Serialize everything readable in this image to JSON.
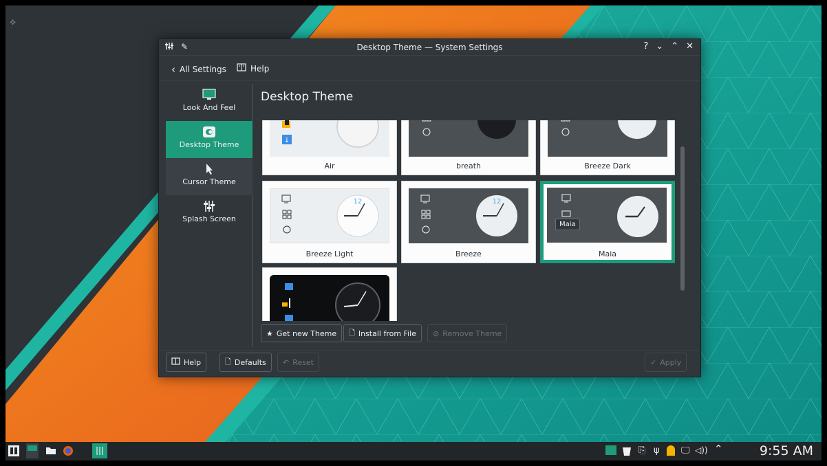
{
  "window": {
    "title": "Desktop Theme — System Settings",
    "controls": [
      "?",
      "⌄",
      "⌃",
      "✕"
    ]
  },
  "nav": {
    "back_label": "All Settings",
    "help_label": "Help"
  },
  "sidebar": {
    "items": [
      {
        "label": "Look And Feel",
        "icon": "monitor-icon",
        "active": false
      },
      {
        "label": "Desktop Theme",
        "icon": "toggle-icon",
        "active": true
      },
      {
        "label": "Cursor Theme",
        "icon": "cursor-icon",
        "active": false
      },
      {
        "label": "Splash Screen",
        "icon": "sliders-icon",
        "active": false
      }
    ]
  },
  "page_title": "Desktop Theme",
  "themes": [
    {
      "name": "Air",
      "style": "light"
    },
    {
      "name": "breath",
      "style": "dark"
    },
    {
      "name": "Breeze Dark",
      "style": "light"
    },
    {
      "name": "Breeze Light",
      "style": "light"
    },
    {
      "name": "Breeze",
      "style": "dark"
    },
    {
      "name": "Maia",
      "style": "dark",
      "selected": true
    },
    {
      "name": "",
      "style": "black"
    }
  ],
  "tooltip": "Maia",
  "actions": {
    "get_new": "Get new Theme",
    "install": "Install from File",
    "remove": "Remove Theme"
  },
  "footer": {
    "help": "Help",
    "defaults": "Defaults",
    "reset": "Reset",
    "apply": "Apply"
  },
  "taskbar": {
    "clock": "9:55 AM"
  },
  "colors": {
    "accent": "#1d9b7b",
    "orange": "#f47b20",
    "teal": "#1abc9c"
  }
}
